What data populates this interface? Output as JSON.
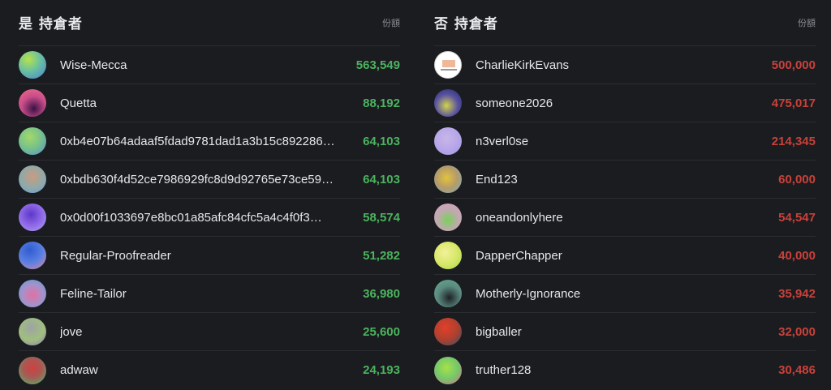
{
  "yes_column": {
    "title": "是 持倉者",
    "amount_label": "份額",
    "holders": [
      {
        "name": "Wise-Mecca",
        "amount": "563,549"
      },
      {
        "name": "Quetta",
        "amount": "88,192"
      },
      {
        "name": "0xb4e07b64adaaf5fdad9781dad1a3b15c892286…",
        "amount": "64,103"
      },
      {
        "name": "0xbdb630f4d52ce7986929fc8d9d92765e73ce59…",
        "amount": "64,103"
      },
      {
        "name": "0x0d00f1033697e8bc01a85afc84cfc5a4c4f0f3…",
        "amount": "58,574"
      },
      {
        "name": "Regular-Proofreader",
        "amount": "51,282"
      },
      {
        "name": "Feline-Tailor",
        "amount": "36,980"
      },
      {
        "name": "jove",
        "amount": "25,600"
      },
      {
        "name": "adwaw",
        "amount": "24,193"
      }
    ]
  },
  "no_column": {
    "title": "否 持倉者",
    "amount_label": "份額",
    "holders": [
      {
        "name": "CharlieKirkEvans",
        "amount": "500,000"
      },
      {
        "name": "someone2026",
        "amount": "475,017"
      },
      {
        "name": "n3verl0se",
        "amount": "214,345"
      },
      {
        "name": "End123",
        "amount": "60,000"
      },
      {
        "name": "oneandonlyhere",
        "amount": "54,547"
      },
      {
        "name": "DapperChapper",
        "amount": "40,000"
      },
      {
        "name": "Motherly-Ignorance",
        "amount": "35,942"
      },
      {
        "name": "bigballer",
        "amount": "32,000"
      },
      {
        "name": "truther128",
        "amount": "30,486"
      }
    ]
  },
  "colors": {
    "background": "#1b1c20",
    "yes_amount": "#4bb35e",
    "no_amount": "#c8413a",
    "divider": "#2c2d32"
  }
}
